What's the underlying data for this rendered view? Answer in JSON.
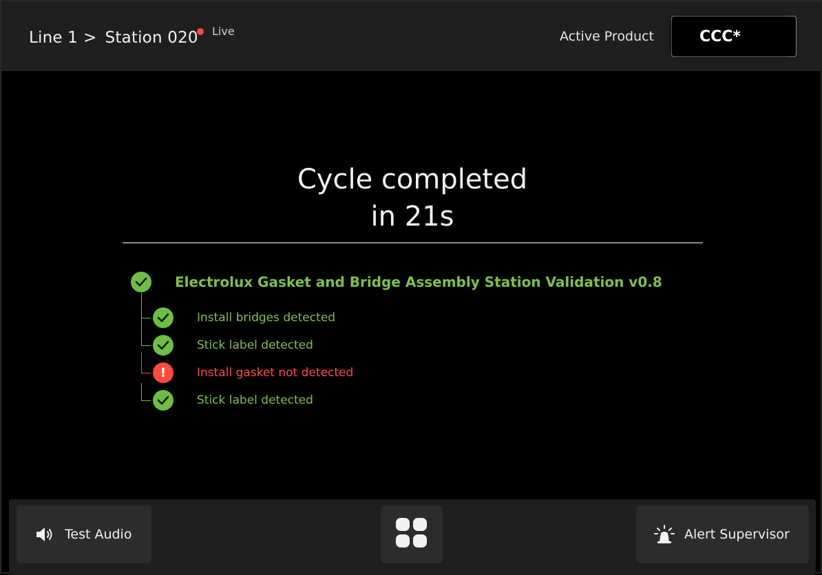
{
  "header": {
    "breadcrumb": [
      "Line 1",
      ">",
      "Station 020"
    ],
    "live_label": "Live",
    "live_color": "#ff4a3d",
    "active_product_label": "Active Product",
    "active_product_value": "CCC*"
  },
  "main": {
    "title_line1": "Cycle completed",
    "title_line2": "in 21s",
    "validation": {
      "name": "Electrolux Gasket and Bridge Assembly Station Validation v0.8",
      "status": "pass",
      "steps": [
        {
          "label": "Install bridges detected",
          "status": "pass"
        },
        {
          "label": "Stick label detected",
          "status": "pass"
        },
        {
          "label": "Install gasket not detected",
          "status": "fail"
        },
        {
          "label": "Stick label detected",
          "status": "pass"
        }
      ]
    },
    "colors": {
      "pass": "#7dc04b",
      "fail": "#ff4a3d"
    }
  },
  "footer": {
    "test_audio_label": "Test Audio",
    "test_audio_icon": "speaker-icon",
    "menu_icon": "grid-icon",
    "alert_label": "Alert Supervisor",
    "alert_icon": "siren-icon"
  }
}
